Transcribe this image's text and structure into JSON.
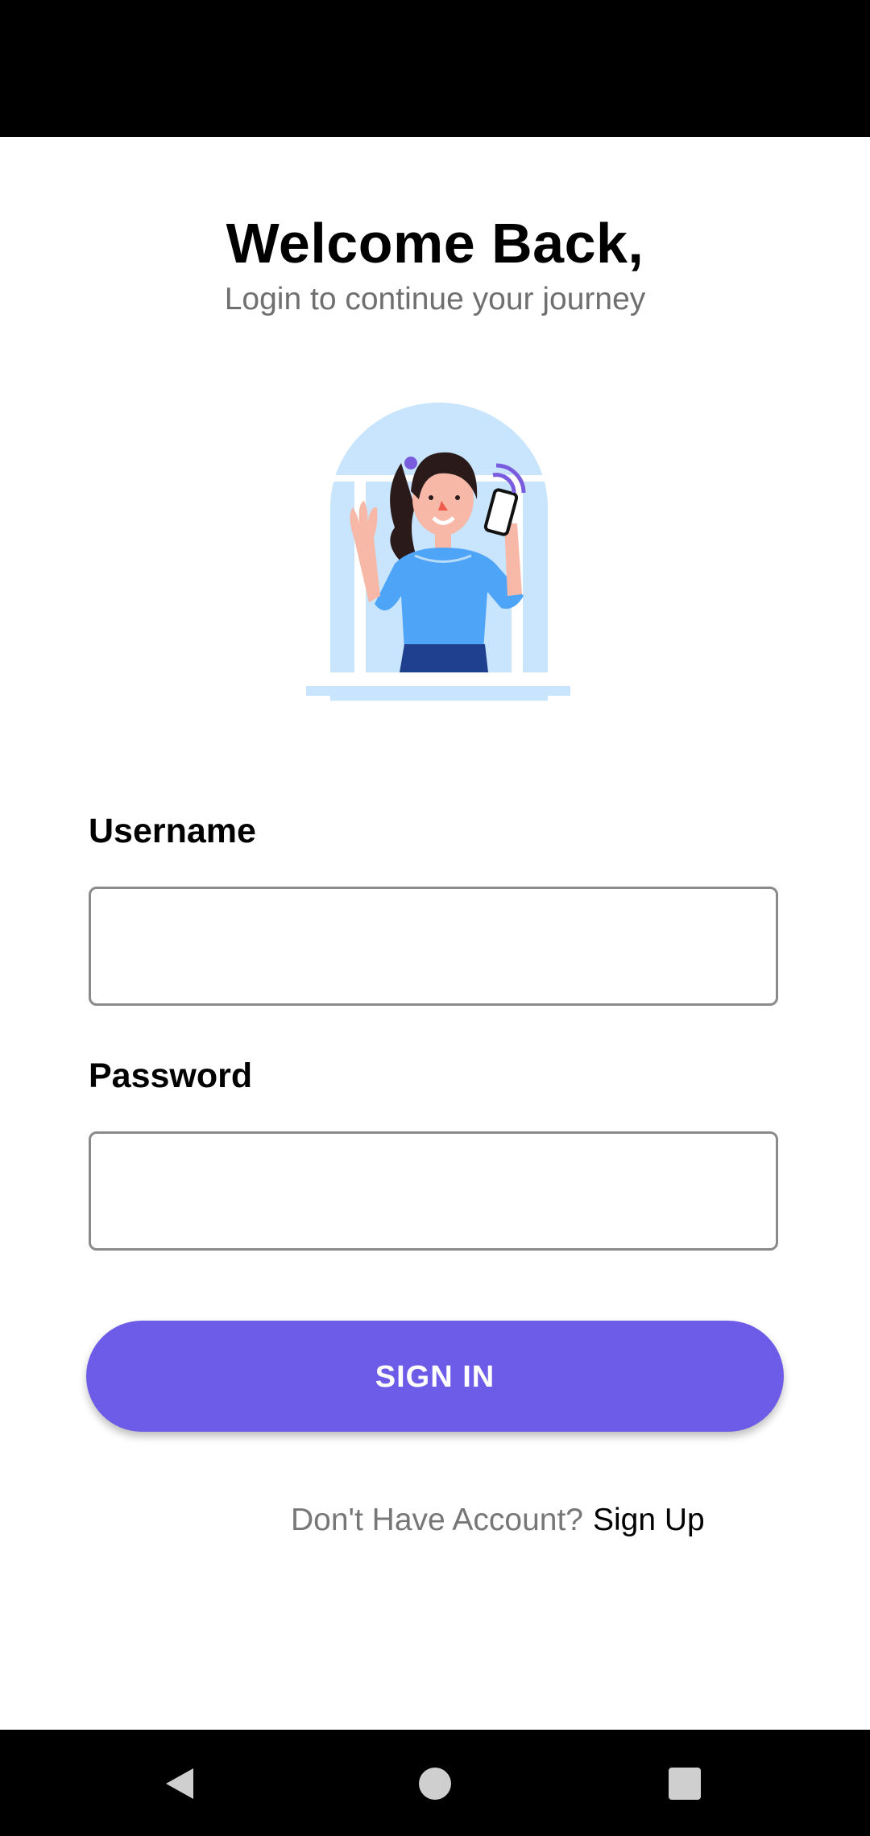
{
  "login": {
    "title": "Welcome Back,",
    "subtitle": "Login to continue your journey",
    "username_label": "Username",
    "username_value": "",
    "password_label": "Password",
    "password_value": "",
    "signin_label": "SIGN IN",
    "signup_prompt": "Don't Have Account?",
    "signup_link": "Sign Up"
  },
  "illustration": {
    "icon": "woman-waving-with-phone-illustration"
  },
  "nav": {
    "back_icon": "back-triangle-icon",
    "home_icon": "home-circle-icon",
    "recents_icon": "recents-square-icon"
  },
  "colors": {
    "accent": "#6c5ce7",
    "label_text": "#000000",
    "subtitle_text": "#6f6f6f",
    "input_border": "#8a8a8a",
    "illustration_sky": "#c9e5fd",
    "illustration_shirt": "#4ea5f7"
  }
}
